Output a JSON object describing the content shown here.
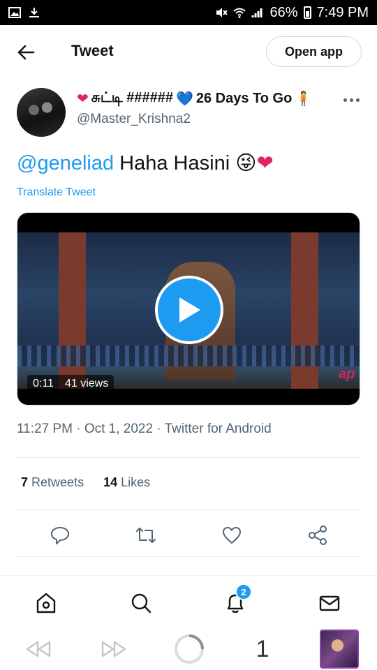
{
  "status_bar": {
    "battery": "66%",
    "time": "7:49 PM"
  },
  "header": {
    "title": "Tweet",
    "open_app": "Open app"
  },
  "author": {
    "display_name": "சுட்டி ######",
    "countdown": "26 Days To Go",
    "handle": "@Master_Krishna2"
  },
  "tweet": {
    "mention": "@geneliad",
    "text": " Haha Hasini ",
    "translate": "Translate Tweet"
  },
  "media": {
    "duration": "0:11",
    "views": "41 views"
  },
  "meta": {
    "time": "11:27 PM",
    "date": "Oct 1, 2022",
    "source": "Twitter for Android"
  },
  "stats": {
    "retweets_count": "7",
    "retweets_label": "Retweets",
    "likes_count": "14",
    "likes_label": "Likes"
  },
  "nav": {
    "notification_count": "2"
  },
  "browser": {
    "tab_count": "1"
  },
  "colors": {
    "accent": "#1d9bf0",
    "text": "#0f1419",
    "muted": "#536471"
  }
}
